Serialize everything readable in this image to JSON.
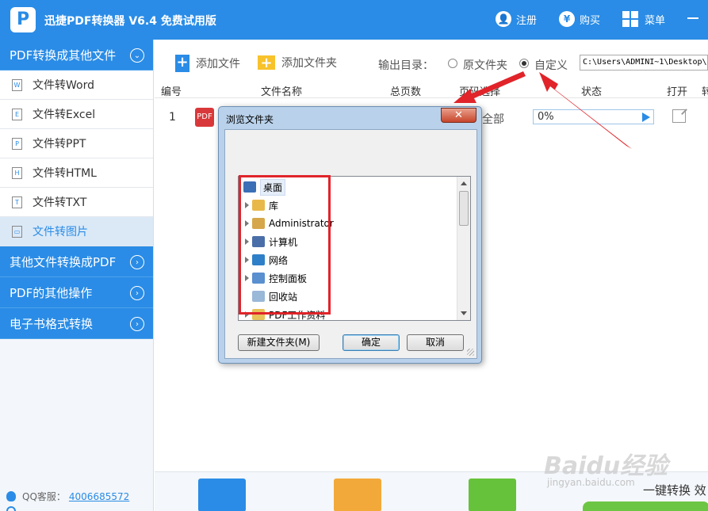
{
  "app": {
    "title": "迅捷PDF转换器 V6.4 免费试用版",
    "logo_letter": "P",
    "register": "注册",
    "buy": "购买",
    "menu": "菜单",
    "register_icon_glyph": "👤",
    "buy_icon_glyph": "¥"
  },
  "sidebar": {
    "categories": [
      {
        "label": "PDF转换成其他文件",
        "arrow": "⌄"
      },
      {
        "label": "其他文件转换成PDF",
        "arrow": "›"
      },
      {
        "label": "PDF的其他操作",
        "arrow": "›"
      },
      {
        "label": "电子书格式转换",
        "arrow": "›"
      }
    ],
    "items": [
      {
        "label": "文件转Word",
        "icon": "W"
      },
      {
        "label": "文件转Excel",
        "icon": "E"
      },
      {
        "label": "文件转PPT",
        "icon": "P"
      },
      {
        "label": "文件转HTML",
        "icon": "H"
      },
      {
        "label": "文件转TXT",
        "icon": "T"
      },
      {
        "label": "文件转图片",
        "icon": "▭"
      }
    ],
    "qq_label": "QQ客服：",
    "qq_number": "4006685572"
  },
  "toolbar": {
    "add_file": "添加文件",
    "add_folder": "添加文件夹",
    "output_label": "输出目录：",
    "radio_original": "原文件夹",
    "radio_custom": "自定义",
    "output_path": "C:\\Users\\ADMINI~1\\Desktop\\"
  },
  "table": {
    "headers": {
      "num": "编号",
      "name": "文件名称",
      "pages": "总页数",
      "page_select": "页码选择",
      "status": "状态",
      "open": "打开",
      "last": "转"
    },
    "rows": [
      {
        "num": "1",
        "page_select": "全部",
        "progress": "0%",
        "progress_value": 0
      }
    ]
  },
  "dialog": {
    "title": "浏览文件夹",
    "close": "✕",
    "tree": [
      {
        "label": "桌面",
        "color": "#3b6fb6",
        "expand": false,
        "selected": true
      },
      {
        "label": "库",
        "color": "#e8b94a",
        "expand": true,
        "selected": false
      },
      {
        "label": "Administrator",
        "color": "#d6a64a",
        "expand": true,
        "selected": false
      },
      {
        "label": "计算机",
        "color": "#4a6fa8",
        "expand": true,
        "selected": false
      },
      {
        "label": "网络",
        "color": "#2f7fc8",
        "expand": true,
        "selected": false
      },
      {
        "label": "控制面板",
        "color": "#5a8fd0",
        "expand": true,
        "selected": false
      },
      {
        "label": "回收站",
        "color": "#9ab8d8",
        "expand": false,
        "selected": false
      },
      {
        "label": "PDF工作资料",
        "color": "#e8c25a",
        "expand": true,
        "selected": false
      }
    ],
    "new_folder": "新建文件夹(M)",
    "ok": "确定",
    "cancel": "取消"
  },
  "bottom": {
    "text": "一键转换  效"
  },
  "watermark": {
    "logo": "Baidu经验",
    "url": "jingyan.baidu.com"
  },
  "colors": {
    "accent": "#2a8ce6",
    "highlight_red": "#e0242a"
  }
}
